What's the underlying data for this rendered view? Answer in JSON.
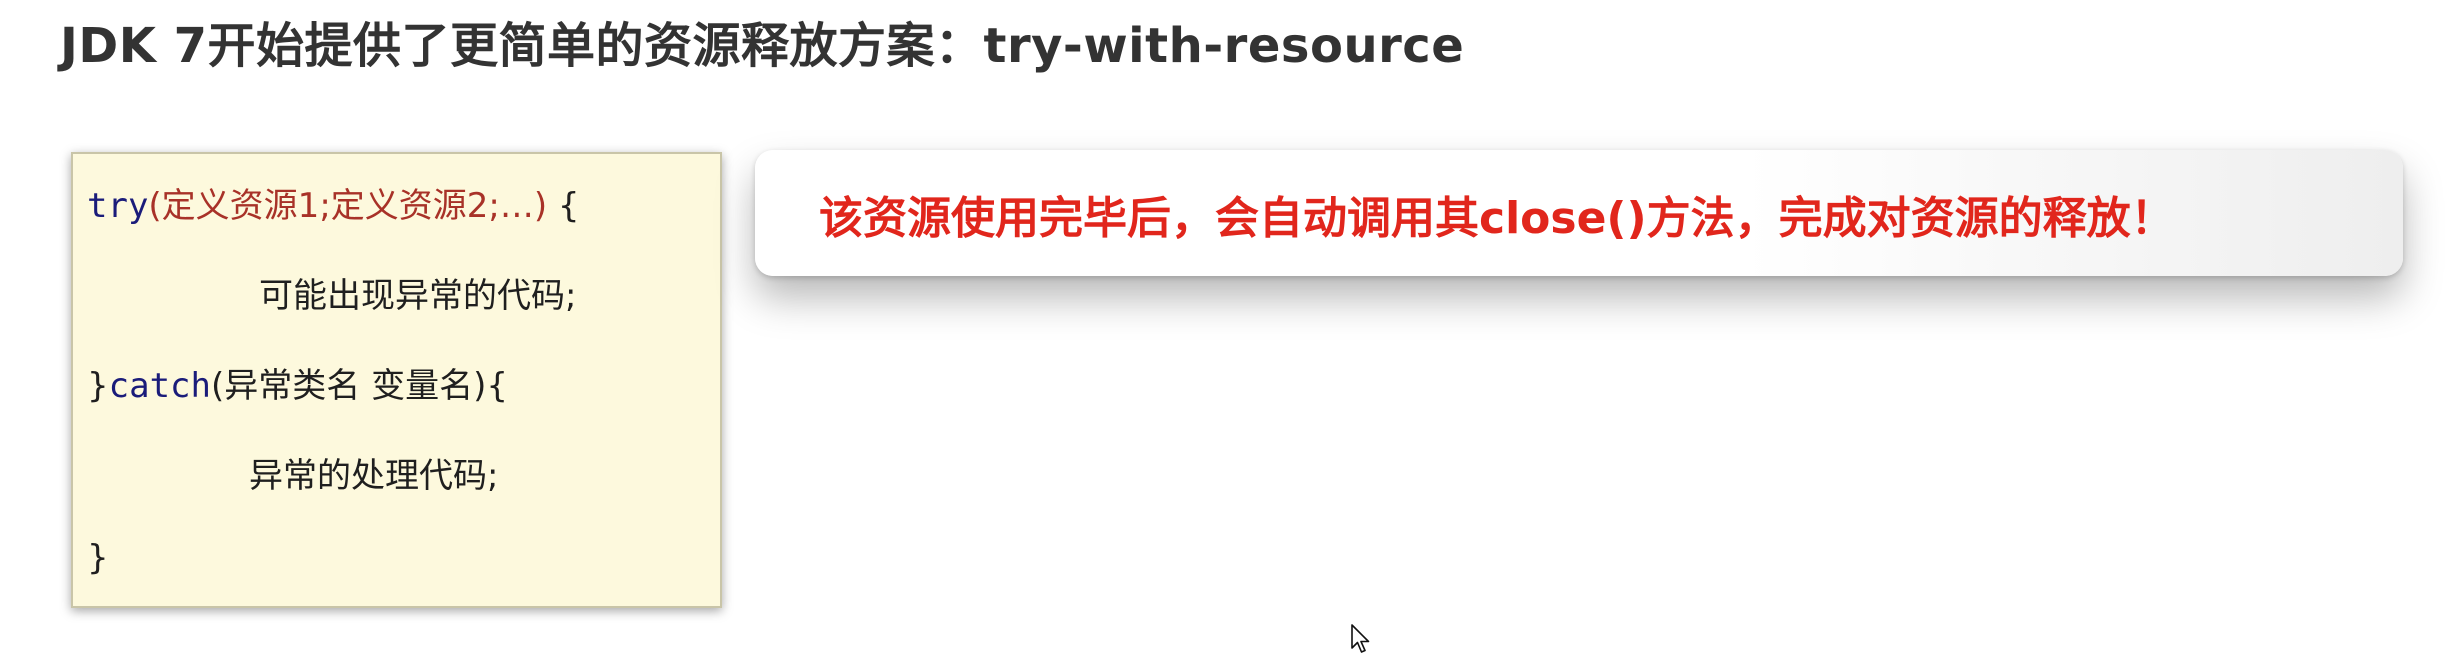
{
  "slide": {
    "title": "JDK 7开始提供了更简单的资源释放方案：try-with-resource"
  },
  "code": {
    "line1_keyword": "try",
    "line1_resources": "(定义资源1;定义资源2;…)",
    "line1_brace": " {",
    "line2": "可能出现异常的代码;",
    "line3_brace": "}",
    "line3_keyword": "catch",
    "line3_rest": "(异常类名 变量名){",
    "line4": "异常的处理代码;",
    "line5": "}"
  },
  "callout": {
    "text": "该资源使用完毕后，会自动调用其close()方法，完成对资源的释放！"
  },
  "colors": {
    "title": "#333333",
    "code_background": "#fdf9dd",
    "code_keyword": "#1a1c7a",
    "code_resource": "#a83228",
    "callout_text": "#e1261c"
  },
  "icons": {
    "cursor": "mouse-pointer-icon"
  }
}
